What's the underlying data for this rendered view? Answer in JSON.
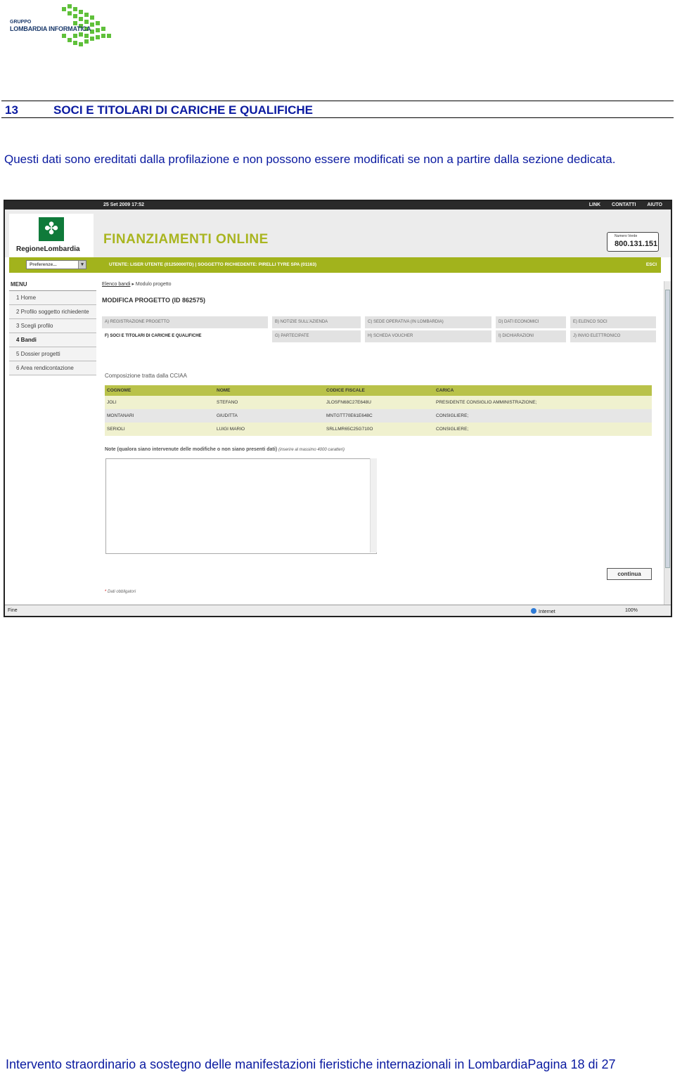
{
  "logo": {
    "line1": "GRUPPO",
    "line2": "LOMBARDIA INFORMATICA"
  },
  "section": {
    "number": "13",
    "title": "SOCI E TITOLARI DI CARICHE E QUALIFICHE"
  },
  "intro": "Questi dati sono ereditati dalla profilazione e non possono essere modificati se non a partire dalla sezione dedicata.",
  "footer": "Intervento straordinario a sostegno delle manifestazioni fieristiche internazionali in LombardiaPagina 18 di 27",
  "screenshot": {
    "topbar": {
      "date": "25 Set 2009 17:52",
      "links": [
        "LINK",
        "CONTATTI",
        "AIUTO"
      ]
    },
    "brand": "RegioneLombardia",
    "app_title": "FINANZIAMENTI ONLINE",
    "phone": {
      "label": "Numero Verde",
      "number": "800.131.151"
    },
    "preferences": "Preferenze...",
    "user_line": "UTENTE: LISER UTENTE (01250000TD)  |  SOGGETTO RICHIEDENTE: PIRELLI TYRE SPA (01163)",
    "exit": "ESCI",
    "menu": {
      "title": "MENU",
      "items": [
        "1  Home",
        "2  Profilo soggetto richiedente",
        "3  Scegli profilo",
        "4  Bandi",
        "5  Dossier progetti",
        "6  Area rendicontazione"
      ],
      "active_index": 3
    },
    "breadcrumb": {
      "link": "Elenco bandi",
      "current": "Modulo progetto"
    },
    "page_title": "MODIFICA PROGETTO (ID 862575)",
    "tabs": [
      "A) REGISTRAZIONE PROGETTO",
      "B) NOTIZIE SULL'AZIENDA",
      "C) SEDE OPERATIVA (IN LOMBARDIA)",
      "D) DATI ECONOMICI",
      "E) ELENCO SOCI",
      "F) SOCI E TITOLARI DI CARICHE E QUALIFICHE",
      "G) PARTECIPATE",
      "H) SCHEDA VOUCHER",
      "I) DICHIARAZIONI",
      "J) INVIO ELETTRONICO"
    ],
    "active_tab_index": 5,
    "caption": "Composizione tratta dalla CCIAA",
    "table": {
      "headers": [
        "COGNOME",
        "NOME",
        "CODICE FISCALE",
        "CARICA"
      ],
      "rows": [
        [
          "JOLI",
          "STEFANO",
          "JLOSFN68C27E648U",
          "PRESIDENTE CONSIGLIO AMMINISTRAZIONE;"
        ],
        [
          "MONTANARI",
          "GIUDITTA",
          "MNTGTT70E61E648C",
          "CONSIGLIERE;"
        ],
        [
          "SERIOLI",
          "LUIGI MARIO",
          "SRLLMR65C25G710O",
          "CONSIGLIERE;"
        ]
      ]
    },
    "notes_label": "Note (qualora siano intervenute delle modifiche o non siano presenti dati)",
    "notes_hint": "(inserire al massimo 4000 caratteri)",
    "notes_value": "",
    "continue_label": "continua",
    "required_note": "Dati obbligatori",
    "statusbar": {
      "left": "Fine",
      "zone": "Internet",
      "zoom": "100%"
    }
  }
}
